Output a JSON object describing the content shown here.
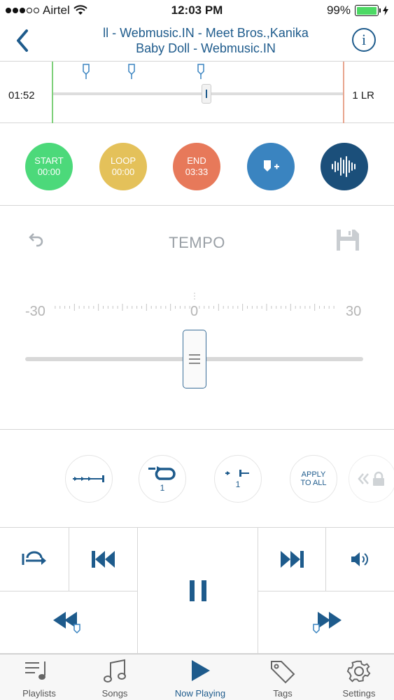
{
  "status_bar": {
    "carrier": "Airtel",
    "time": "12:03 PM",
    "battery_percent": "99%",
    "battery_level": 0.99
  },
  "header": {
    "title_line1": "ll - Webmusic.IN - Meet Bros.,Kanika",
    "title_line2": "Baby Doll - Webmusic.IN"
  },
  "timeline": {
    "current_time": "01:52",
    "channel": "1 LR"
  },
  "controls": {
    "start": {
      "label": "START",
      "time": "00:00",
      "color": "#4cd97a"
    },
    "loop": {
      "label": "LOOP",
      "time": "00:00",
      "color": "#e4c15a"
    },
    "end": {
      "label": "END",
      "time": "03:33",
      "color": "#e7795a"
    },
    "add_marker_color": "#3a84c0",
    "waveform_color": "#1b4f7a"
  },
  "tempo": {
    "label": "TEMPO",
    "min": "-30",
    "zero": "0",
    "max": "30",
    "value": 0
  },
  "loop_controls": {
    "repeat_count": "1",
    "gap_count": "1",
    "apply_label_1": "APPLY",
    "apply_label_2": "TO ALL"
  },
  "tabs": [
    {
      "label": "Playlists",
      "icon": "playlist-icon"
    },
    {
      "label": "Songs",
      "icon": "music-note-icon"
    },
    {
      "label": "Now Playing",
      "icon": "play-icon"
    },
    {
      "label": "Tags",
      "icon": "tag-icon"
    },
    {
      "label": "Settings",
      "icon": "gear-icon"
    }
  ],
  "colors": {
    "accent": "#1e5b8c"
  }
}
